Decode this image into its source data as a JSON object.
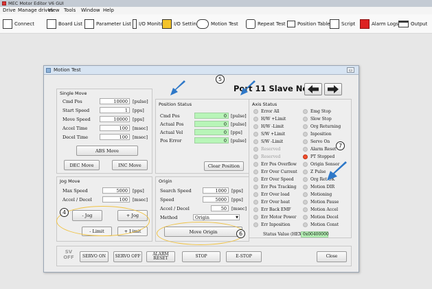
{
  "app": {
    "title": "MEC Motor Editor V6 GUI"
  },
  "menu": [
    "Drive",
    "Manage drives",
    "View",
    "Tools",
    "Window",
    "Help"
  ],
  "toolbar": [
    {
      "label": "Connect",
      "icon": "connect-icon"
    },
    {
      "label": "Board List",
      "icon": "board-list-icon"
    },
    {
      "label": "Parameter List",
      "icon": "parameter-list-icon"
    },
    {
      "label": "I/O Monitor",
      "icon": "io-monitor-icon"
    },
    {
      "label": "I/O Setting",
      "icon": "io-setting-icon"
    },
    {
      "label": "Motion Test",
      "icon": "motion-test-icon"
    },
    {
      "label": "Repeat Test",
      "icon": "repeat-test-icon"
    },
    {
      "label": "Position Table",
      "icon": "position-table-icon"
    },
    {
      "label": "Script",
      "icon": "script-icon"
    },
    {
      "label": "Alarm Logs",
      "icon": "alarm-logs-icon"
    },
    {
      "label": "Output",
      "icon": "output-icon"
    }
  ],
  "dialog": {
    "title": "Motion Test",
    "device": "Port 11 Slave No 0",
    "single_move": {
      "title": "Single Move",
      "rows": [
        {
          "label": "Cmd Pos",
          "value": "10000",
          "unit": "[pulse]"
        },
        {
          "label": "Start Speed",
          "value": "1",
          "unit": "[pps]"
        },
        {
          "label": "Move Speed",
          "value": "10000",
          "unit": "[pps]"
        },
        {
          "label": "Accel Time",
          "value": "100",
          "unit": "[msec]"
        },
        {
          "label": "Decel Time",
          "value": "100",
          "unit": "[msec]"
        }
      ],
      "abs_move": "ABS Move",
      "dec_move": "DEC Move",
      "inc_move": "INC Move"
    },
    "position_status": {
      "title": "Position Status",
      "rows": [
        {
          "label": "Cmd Pos",
          "value": "0",
          "unit": "[pulse]"
        },
        {
          "label": "Actual Pos",
          "value": "0",
          "unit": "[pulse]"
        },
        {
          "label": "Actual Vel",
          "value": "0",
          "unit": "[pps]"
        },
        {
          "label": "Pos Error",
          "value": "0",
          "unit": "[pulse]"
        }
      ],
      "clear": "Clear Position"
    },
    "axis_status": {
      "title": "Axis Status",
      "left": [
        {
          "label": "Error All",
          "on": false,
          "dim": false
        },
        {
          "label": "H/W +Limit",
          "on": false,
          "dim": false
        },
        {
          "label": "H/W -Limit",
          "on": false,
          "dim": false
        },
        {
          "label": "S/W +Limit",
          "on": false,
          "dim": false
        },
        {
          "label": "S/W -Limit",
          "on": false,
          "dim": false
        },
        {
          "label": "Reserved",
          "on": false,
          "dim": true
        },
        {
          "label": "Reserved",
          "on": false,
          "dim": true
        },
        {
          "label": "Err Pos Overflow",
          "on": false,
          "dim": false
        },
        {
          "label": "Err Over Current",
          "on": false,
          "dim": false
        },
        {
          "label": "Err Over Speed",
          "on": false,
          "dim": false
        },
        {
          "label": "Err Pos Tracking",
          "on": false,
          "dim": false
        },
        {
          "label": "Err Over load",
          "on": false,
          "dim": false
        },
        {
          "label": "Err Over heat",
          "on": false,
          "dim": false
        },
        {
          "label": "Err Back EMF",
          "on": false,
          "dim": false
        },
        {
          "label": "Err Motor Power",
          "on": false,
          "dim": false
        },
        {
          "label": "Err Inposition",
          "on": false,
          "dim": false
        }
      ],
      "right": [
        {
          "label": "Emg Stop",
          "on": false,
          "dim": false
        },
        {
          "label": "Slow Stop",
          "on": false,
          "dim": false
        },
        {
          "label": "Org Returning",
          "on": false,
          "dim": false
        },
        {
          "label": "Inposition",
          "on": false,
          "dim": false
        },
        {
          "label": "Servo On",
          "on": false,
          "dim": false
        },
        {
          "label": "Alarm Reset",
          "on": false,
          "dim": false
        },
        {
          "label": "PT Stopped",
          "on": true,
          "dim": false
        },
        {
          "label": "Origin Sensor",
          "on": false,
          "dim": false
        },
        {
          "label": "Z Pulse",
          "on": false,
          "dim": false
        },
        {
          "label": "Org Ret OK",
          "on": false,
          "dim": false
        },
        {
          "label": "Motion DIR",
          "on": false,
          "dim": false
        },
        {
          "label": "Motioning",
          "on": false,
          "dim": false
        },
        {
          "label": "Motion Pause",
          "on": false,
          "dim": false
        },
        {
          "label": "Motion Accel",
          "on": false,
          "dim": false
        },
        {
          "label": "Motion Decel",
          "on": false,
          "dim": false
        },
        {
          "label": "Motion Const",
          "on": false,
          "dim": false
        }
      ],
      "status_label": "Status Value (HEX)",
      "status_value": "0x00400000"
    },
    "jog": {
      "title": "Jog Move",
      "rows": [
        {
          "label": "Max Speed",
          "value": "5000",
          "unit": "[pps]"
        },
        {
          "label": "Accel / Decel",
          "value": "100",
          "unit": "[msec]"
        }
      ],
      "minus_jog": "- Jog",
      "plus_jog": "+ Jog",
      "minus_limit": "- Limit",
      "plus_limit": "+ Limit"
    },
    "origin": {
      "title": "Origin",
      "rows": [
        {
          "label": "Search Speed",
          "value": "1000",
          "unit": "[pps]"
        },
        {
          "label": "Speed",
          "value": "5000",
          "unit": "[pps]"
        },
        {
          "label": "Accel / Decel",
          "value": "50",
          "unit": "[msec]"
        }
      ],
      "method_label": "Method",
      "method_value": "Origin",
      "move_origin": "Move Origin"
    },
    "footer": {
      "sv_off": "SV OFF",
      "servo_on": "SERVO ON",
      "servo_off": "SERVO OFF",
      "alarm_reset": "ALARM RESET",
      "stop": "STOP",
      "estop": "E-STOP",
      "close": "Close"
    },
    "callouts": [
      "4",
      "5",
      "6",
      "7"
    ]
  },
  "colors": {
    "led_on": "#f05030",
    "field_green": "#b8f5b8",
    "arrow": "#2e78c8",
    "highlight": "#f0c242"
  }
}
